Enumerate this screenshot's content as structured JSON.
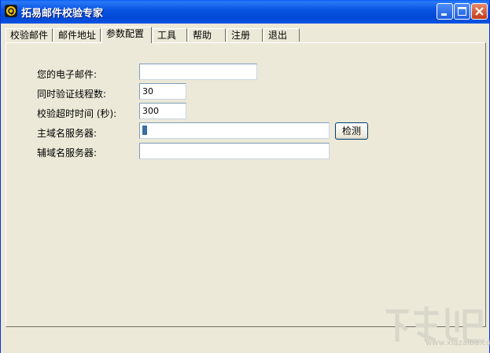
{
  "window": {
    "title": "拓易邮件校验专家"
  },
  "tabs": [
    {
      "label": "校验邮件"
    },
    {
      "label": "邮件地址"
    },
    {
      "label": "参数配置"
    },
    {
      "label": "工具"
    },
    {
      "label": "帮助"
    },
    {
      "label": "注册"
    },
    {
      "label": "退出"
    }
  ],
  "active_tab": "参数配置",
  "form": {
    "email_label": "您的电子邮件:",
    "email_value": "",
    "threads_label": "同时验证线程数:",
    "threads_value": "30",
    "timeout_label": "校验超时时间 (秒):",
    "timeout_value": "300",
    "primary_dns_label": "主域名服务器:",
    "primary_dns_value": "",
    "detect_button": "检测",
    "secondary_dns_label": "辅域名服务器:",
    "secondary_dns_value": ""
  },
  "watermark": {
    "text": "www.xiazaiba.com"
  },
  "colors": {
    "titlebar": "#0a55e3",
    "background": "#ece9d8",
    "close_button": "#c2391a"
  }
}
